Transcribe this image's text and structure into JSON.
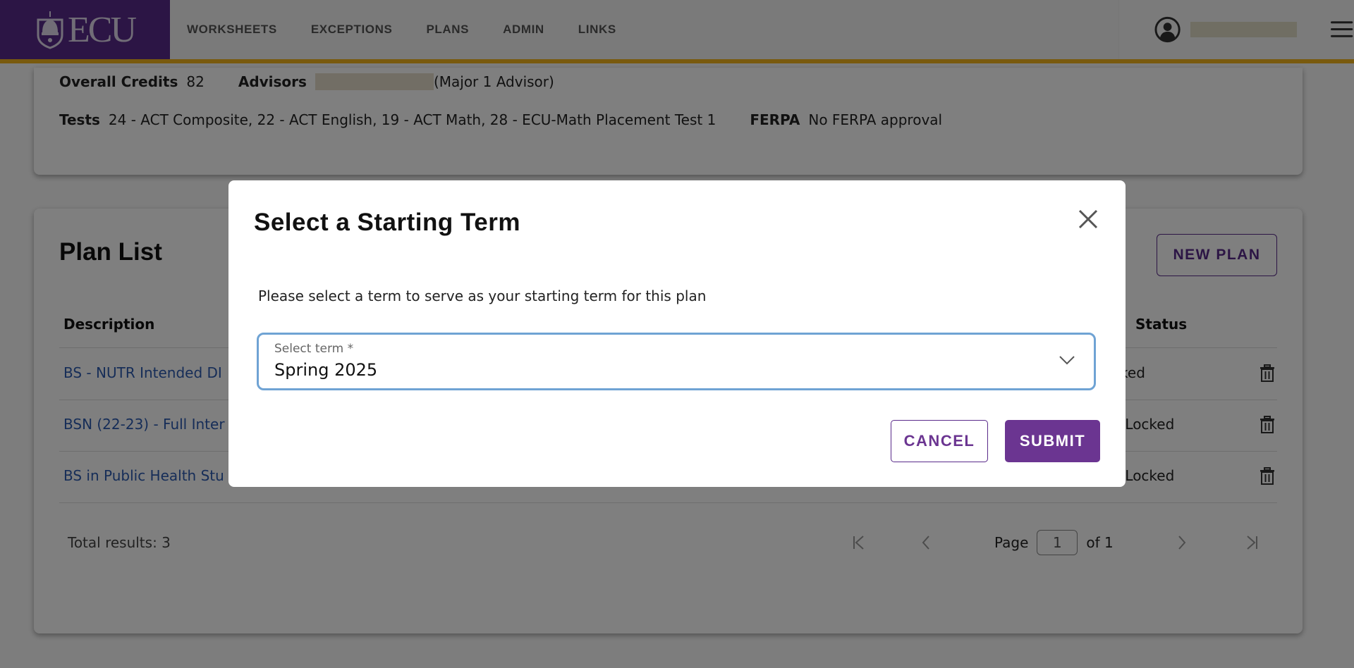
{
  "header": {
    "logo_text": "ECU",
    "nav": [
      {
        "label": "WORKSHEETS"
      },
      {
        "label": "EXCEPTIONS"
      },
      {
        "label": "PLANS"
      },
      {
        "label": "ADMIN"
      },
      {
        "label": "LINKS"
      }
    ],
    "icons": {
      "user": "user-circle-icon",
      "menu": "hamburger-menu-icon"
    }
  },
  "student_info": {
    "overall_credits_label": "Overall Credits",
    "overall_credits_value": "82",
    "advisors_label": "Advisors",
    "advisor_role": "(Major 1 Advisor)",
    "tests_label": "Tests",
    "tests_value": "24 - ACT Composite, 22 - ACT English, 19 - ACT Math, 28 - ECU-Math Placement Test 1",
    "ferpa_label": "FERPA",
    "ferpa_value": "No FERPA approval"
  },
  "plan_list": {
    "title": "Plan List",
    "new_plan_label": "NEW PLAN",
    "columns": {
      "description": "Description",
      "status": "Status"
    },
    "rows": [
      {
        "description": "BS - NUTR Intended DI",
        "status": "Locked"
      },
      {
        "description": "BSN (22-23) - Full Inter",
        "status": "Not Locked"
      },
      {
        "description": "BS in Public Health Stu",
        "status": "Not Locked"
      }
    ],
    "total_results": "Total results: 3",
    "pagination": {
      "page_label": "Page",
      "page_value": "1",
      "of_label": "of 1"
    }
  },
  "modal": {
    "title": "Select a Starting Term",
    "description": "Please select a term to serve as your starting term for this plan",
    "select_label": "Select term *",
    "select_value": "Spring 2025",
    "cancel_label": "CANCEL",
    "submit_label": "SUBMIT"
  },
  "colors": {
    "brand_purple": "#592a8a",
    "accent_gold": "#f2b51d",
    "button_purple": "#6b3591",
    "focus_blue": "#6fa3d4",
    "link_blue": "#2c5bb0"
  }
}
